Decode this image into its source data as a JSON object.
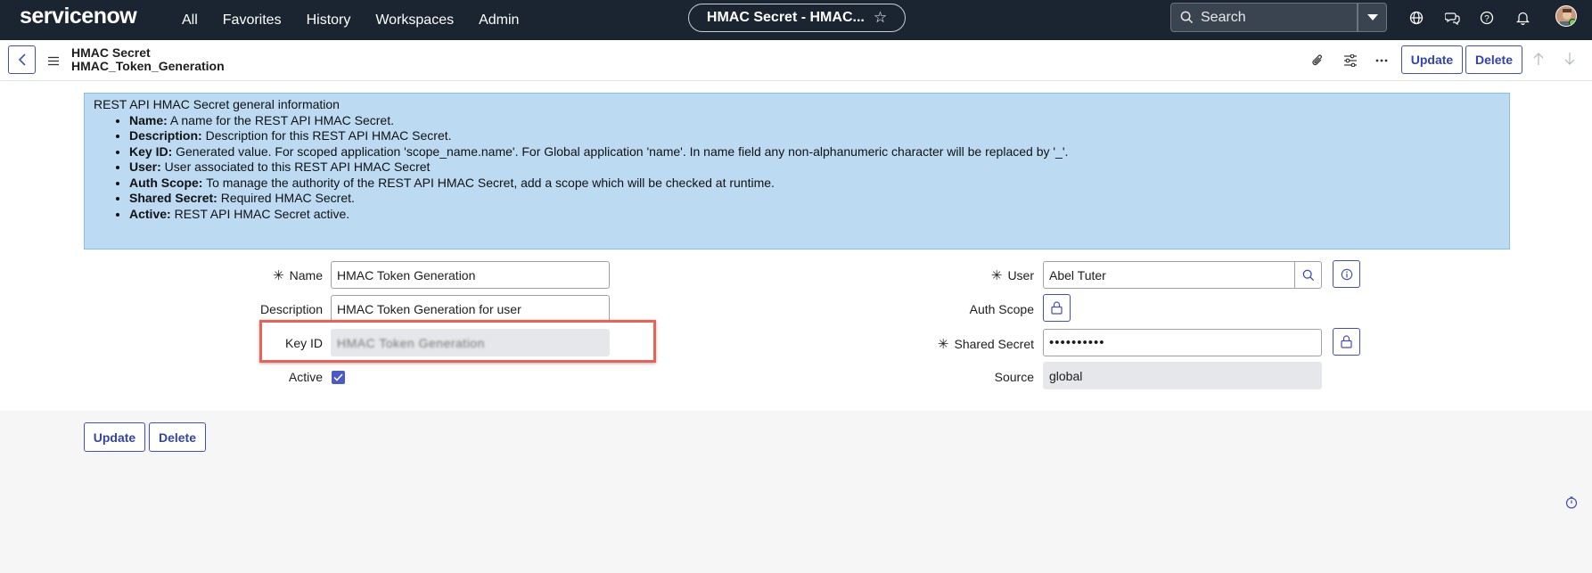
{
  "topnav": {
    "logo": "servicenow",
    "items": [
      "All",
      "Favorites",
      "History",
      "Workspaces",
      "Admin"
    ],
    "title_pill": "HMAC Secret - HMAC...",
    "search_placeholder": "Search",
    "icons": [
      "globe-icon",
      "chat-icon",
      "help-icon",
      "bell-icon",
      "user-avatar"
    ]
  },
  "record": {
    "table": "HMAC Secret",
    "name": "HMAC_Token_Generation",
    "update_label": "Update",
    "delete_label": "Delete"
  },
  "info": {
    "heading": "REST API HMAC Secret general information",
    "items": [
      {
        "term": "Name:",
        "text": " A name for the REST API HMAC Secret."
      },
      {
        "term": "Description:",
        "text": " Description for this REST API HMAC Secret."
      },
      {
        "term": "Key ID:",
        "text": " Generated value. For scoped application 'scope_name.name'. For Global application 'name'. In name field any non-alphanumeric character will be replaced by '_'."
      },
      {
        "term": "User:",
        "text": " User associated to this REST API HMAC Secret"
      },
      {
        "term": "Auth Scope:",
        "text": " To manage the authority of the REST API HMAC Secret, add a scope which will be checked at runtime."
      },
      {
        "term": "Shared Secret:",
        "text": " Required HMAC Secret."
      },
      {
        "term": "Active:",
        "text": " REST API HMAC Secret active."
      }
    ]
  },
  "form": {
    "name_label": "Name",
    "name_value": "HMAC Token Generation",
    "description_label": "Description",
    "description_value": "HMAC Token Generation for user",
    "keyid_label": "Key ID",
    "keyid_value": "HMAC Token Generation",
    "active_label": "Active",
    "active_checked": true,
    "user_label": "User",
    "user_value": "Abel Tuter",
    "auth_scope_label": "Auth Scope",
    "shared_secret_label": "Shared Secret",
    "shared_secret_value": "••••••••••",
    "source_label": "Source",
    "source_value": "global",
    "required_mark": "✳"
  },
  "colors": {
    "nav_bg": "#1b2431",
    "accent": "#4050b5",
    "info_bg": "#bcdbf2",
    "highlight": "#e86355"
  }
}
